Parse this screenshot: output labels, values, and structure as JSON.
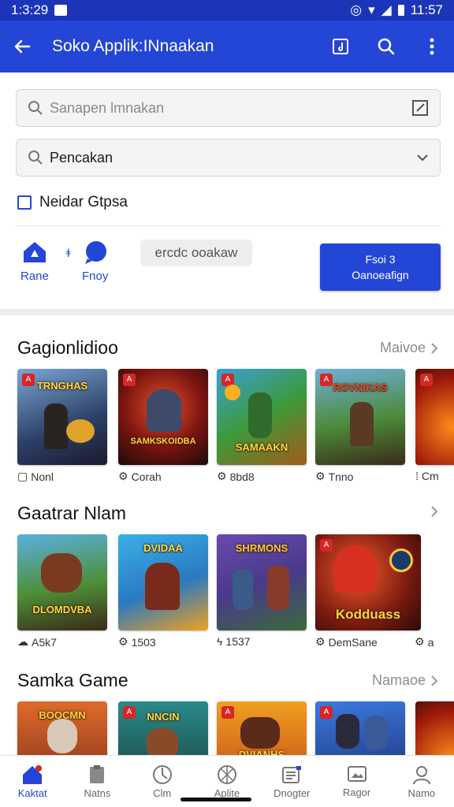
{
  "status_bar": {
    "time": "1:3:29",
    "right_time": "11:57"
  },
  "app_bar": {
    "title": "Soko Applik:INnaakan"
  },
  "search": {
    "placeholder": "Sanapen lmnakan"
  },
  "dropdown": {
    "value": "Pencakan"
  },
  "checkbox": {
    "label": "Neidar Gtpsa"
  },
  "quick_actions": [
    {
      "label": "Rane",
      "icon": "home-icon"
    },
    {
      "label": "Fnoy",
      "icon": "chat-icon"
    }
  ],
  "quick_prefix": "ꬸ",
  "chip": {
    "label": "ercdc ooakaw"
  },
  "primary_button": {
    "line1": "Fsoi 3",
    "line2": "Oanoeafign"
  },
  "sections": [
    {
      "title": "Gagionlidioo",
      "more": "Maivoe",
      "tiles": [
        {
          "title": "TRNGHAS",
          "label": "Nonl",
          "icon": "square-icon"
        },
        {
          "title": "SAMKSKOIDBA",
          "label": "Corah",
          "icon": "puzzle-icon"
        },
        {
          "title": "SAMAAKN",
          "label": "8bd8",
          "icon": "gear-icon"
        },
        {
          "title": "ROVNIKAS",
          "label": "Tnno",
          "icon": "gear-icon"
        },
        {
          "title": "",
          "label": "Cm",
          "icon": "pin-icon"
        }
      ]
    },
    {
      "title": "Gaatrar Nlam",
      "more": "",
      "tiles": [
        {
          "title": "DLOMDVBA",
          "label": "A5k7",
          "icon": "cloud-icon"
        },
        {
          "title": "DVIDAA",
          "label": "1503",
          "icon": "gear-icon"
        },
        {
          "title": "SHRMONS",
          "label": "1537",
          "icon": "bolt-icon"
        },
        {
          "title": "Kodduass",
          "label": "DemSane",
          "icon": "gear-icon"
        },
        {
          "title": "",
          "label": "a",
          "icon": "gear-icon"
        }
      ]
    },
    {
      "title": "Samka Game",
      "more": "Namaoe",
      "tiles": [
        {
          "title": "BOOCMN",
          "label": "",
          "icon": ""
        },
        {
          "title": "NNCIN",
          "label": "",
          "icon": ""
        },
        {
          "title": "DVIANHS",
          "label": "",
          "icon": ""
        },
        {
          "title": "",
          "label": "",
          "icon": ""
        },
        {
          "title": "",
          "label": "",
          "icon": ""
        }
      ]
    }
  ],
  "bottom_nav": [
    {
      "label": "Kaktat",
      "icon": "home-icon",
      "active": true
    },
    {
      "label": "Natns",
      "icon": "clipboard-icon",
      "active": false
    },
    {
      "label": "Clm",
      "icon": "compass-icon",
      "active": false
    },
    {
      "label": "Aplite",
      "icon": "aperture-icon",
      "active": false
    },
    {
      "label": "Dnogter",
      "icon": "news-icon",
      "active": false
    },
    {
      "label": "Ragor",
      "icon": "image-icon",
      "active": false
    },
    {
      "label": "Namo",
      "icon": "person-icon",
      "active": false
    }
  ],
  "colors": {
    "primary": "#2446d6",
    "status_bar": "#1c35b8"
  }
}
